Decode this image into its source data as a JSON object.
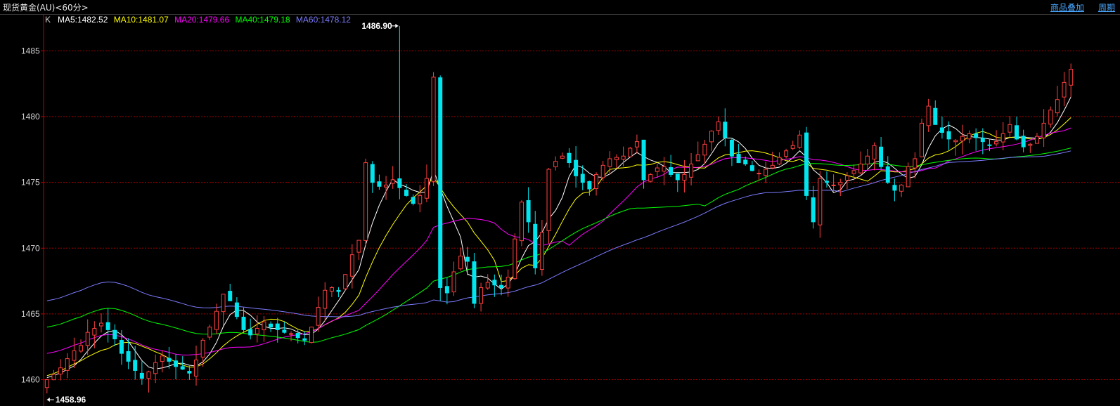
{
  "header": {
    "title": "现货黄金(AU)<60分>",
    "overlay_label": "商品叠加",
    "period_label": "周期"
  },
  "legend": {
    "k_label": "K",
    "items": [
      {
        "label": "MA5:1482.52",
        "color": "#ffffff"
      },
      {
        "label": "MA10:1481.07",
        "color": "#ffff00"
      },
      {
        "label": "MA20:1479.66",
        "color": "#ff00ff"
      },
      {
        "label": "MA40:1479.18",
        "color": "#00ff00"
      },
      {
        "label": "MA60:1478.12",
        "color": "#7b7bff"
      }
    ]
  },
  "colors": {
    "up": "#ff4040",
    "down": "#00e5ee",
    "grid": "#a00000",
    "axis": "#c00000",
    "text": "#d0d0d0"
  },
  "chart_data": {
    "type": "candlestick",
    "title": "现货黄金(AU)<60分>",
    "ylim": [
      1458,
      1487.8
    ],
    "yticks": [
      1460,
      1465,
      1470,
      1475,
      1480,
      1485
    ],
    "grid": true,
    "annotations": {
      "max": {
        "label": "1486.90",
        "value": 1486.9,
        "index": 52
      },
      "min": {
        "label": "1458.96",
        "value": 1458.96,
        "index": 0
      }
    },
    "close": [
      1460,
      1460.4,
      1460.9,
      1461.6,
      1462.2,
      1462.6,
      1463.6,
      1463.9,
      1464.3,
      1463.8,
      1463.1,
      1462.0,
      1461.4,
      1460.7,
      1460.1,
      1460.6,
      1461.3,
      1461.8,
      1461.4,
      1461.0,
      1460.8,
      1460.5,
      1461.5,
      1463.0,
      1464.0,
      1465.2,
      1466.5,
      1466.0,
      1464.8,
      1463.8,
      1463.4,
      1463.9,
      1464.4,
      1464.0,
      1463.8,
      1463.6,
      1463.5,
      1463.2,
      1463.0,
      1464.0,
      1465.5,
      1466.8,
      1467.0,
      1466.7,
      1468.0,
      1469.5,
      1470.6,
      1476.5,
      1475.0,
      1474.7,
      1474.8,
      1475.2,
      1474.6,
      1474.0,
      1473.4,
      1474.0,
      1475.3,
      1483.0,
      1467.0,
      1466.6,
      1468.2,
      1469.4,
      1469.0,
      1465.8,
      1467.0,
      1467.4,
      1467.2,
      1467.0,
      1467.8,
      1470.7,
      1473.5,
      1472.0,
      1468.5,
      1471.2,
      1476.0,
      1476.6,
      1477.0,
      1476.5,
      1475.5,
      1475.0,
      1474.5,
      1475.6,
      1476.3,
      1476.8,
      1476.9,
      1477.0,
      1477.6,
      1478.1,
      1475.2,
      1475.6,
      1476.1,
      1476.2,
      1475.6,
      1475.2,
      1475.6,
      1476.4,
      1477.1,
      1477.9,
      1478.9,
      1479.6,
      1478.4,
      1477.0,
      1476.5,
      1476.4,
      1475.9,
      1475.7,
      1476.0,
      1476.3,
      1476.9,
      1477.4,
      1477.8,
      1478.6,
      1474.0,
      1472.0,
      1475.3,
      1475.0,
      1474.8,
      1475.0,
      1475.5,
      1475.9,
      1476.4,
      1477.0,
      1477.8,
      1476.2,
      1475.0,
      1474.4,
      1474.8,
      1476.2,
      1476.8,
      1479.5,
      1480.8,
      1479.4,
      1478.8,
      1478.3,
      1478.2,
      1478.5,
      1478.7,
      1478.4,
      1478.1,
      1477.8,
      1478.1,
      1478.7,
      1479.4,
      1478.3,
      1477.7,
      1477.9,
      1478.5,
      1479.5,
      1480.5,
      1481.3,
      1482.6,
      1483.6
    ]
  }
}
